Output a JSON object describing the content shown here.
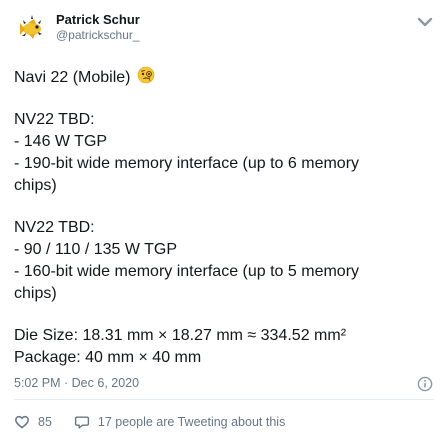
{
  "author": {
    "name": "Patrick Schur",
    "handle": "@patrickschur_"
  },
  "tweet": {
    "title_line": "Navi 22 (Mobile)",
    "title_emoji": "face-with-monocle",
    "block1": {
      "heading": "NV22 TBD:",
      "tgp": "- 146 W TGP",
      "mem_line1": "- 190-bit wide memory interface (up to 6 memory",
      "mem_line2": "chips)"
    },
    "block2": {
      "heading": "NV22 TBD:",
      "tgp": "- 90 / 110 / 135 W TGP",
      "mem_line1": "- 160-bit wide memory interface (up to 5 memory",
      "mem_line2": "chips)"
    },
    "die_size": "Die Size: 18.31 mm × 18.27 mm ≈ 334.52 mm²",
    "package": "Package: 40 mm × 40 mm"
  },
  "meta": {
    "timestamp": "5:02 PM · Dec 6, 2020"
  },
  "footer": {
    "likes": "85",
    "conversation": "17 people are Tweeting about this"
  },
  "colors": {
    "text": "#14171a",
    "secondary": "#657786",
    "divider": "#e6ecf0"
  },
  "icons": [
    "avatar-fish-emblem",
    "chevron-down-icon",
    "face-with-monocle-emoji",
    "info-icon",
    "heart-icon",
    "comment-icon"
  ]
}
